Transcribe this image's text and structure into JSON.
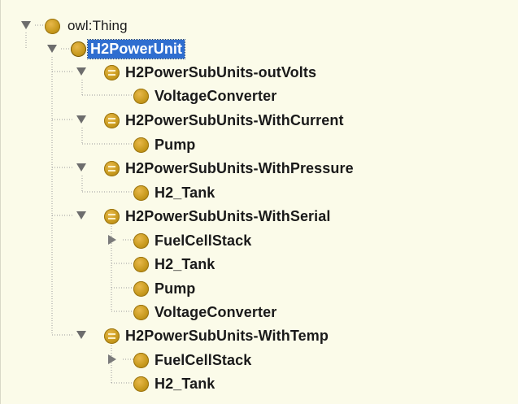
{
  "tree": {
    "root": {
      "label": "owl:Thing"
    },
    "selected": {
      "label": "H2PowerUnit"
    },
    "groups": [
      {
        "label": "H2PowerSubUnits-outVolts",
        "children": [
          {
            "label": "VoltageConverter"
          }
        ]
      },
      {
        "label": "H2PowerSubUnits-WithCurrent",
        "children": [
          {
            "label": "Pump"
          }
        ]
      },
      {
        "label": "H2PowerSubUnits-WithPressure",
        "children": [
          {
            "label": "H2_Tank"
          }
        ]
      },
      {
        "label": "H2PowerSubUnits-WithSerial",
        "children": [
          {
            "label": "FuelCellStack"
          },
          {
            "label": "H2_Tank"
          },
          {
            "label": "Pump"
          },
          {
            "label": "VoltageConverter"
          }
        ]
      },
      {
        "label": "H2PowerSubUnits-WithTemp",
        "children": [
          {
            "label": "FuelCellStack"
          },
          {
            "label": "H2_Tank"
          }
        ]
      }
    ]
  },
  "colors": {
    "panel_bg": "#fbfbe9",
    "selection_bg": "#2f6ed0",
    "class_icon": "#c89a1e",
    "connector_line": "#9a9a9a"
  },
  "icons": {
    "expanded": "triangle-down-icon",
    "collapsed": "triangle-right-icon",
    "class": "class-circle-icon",
    "defined_class": "defined-class-icon"
  }
}
